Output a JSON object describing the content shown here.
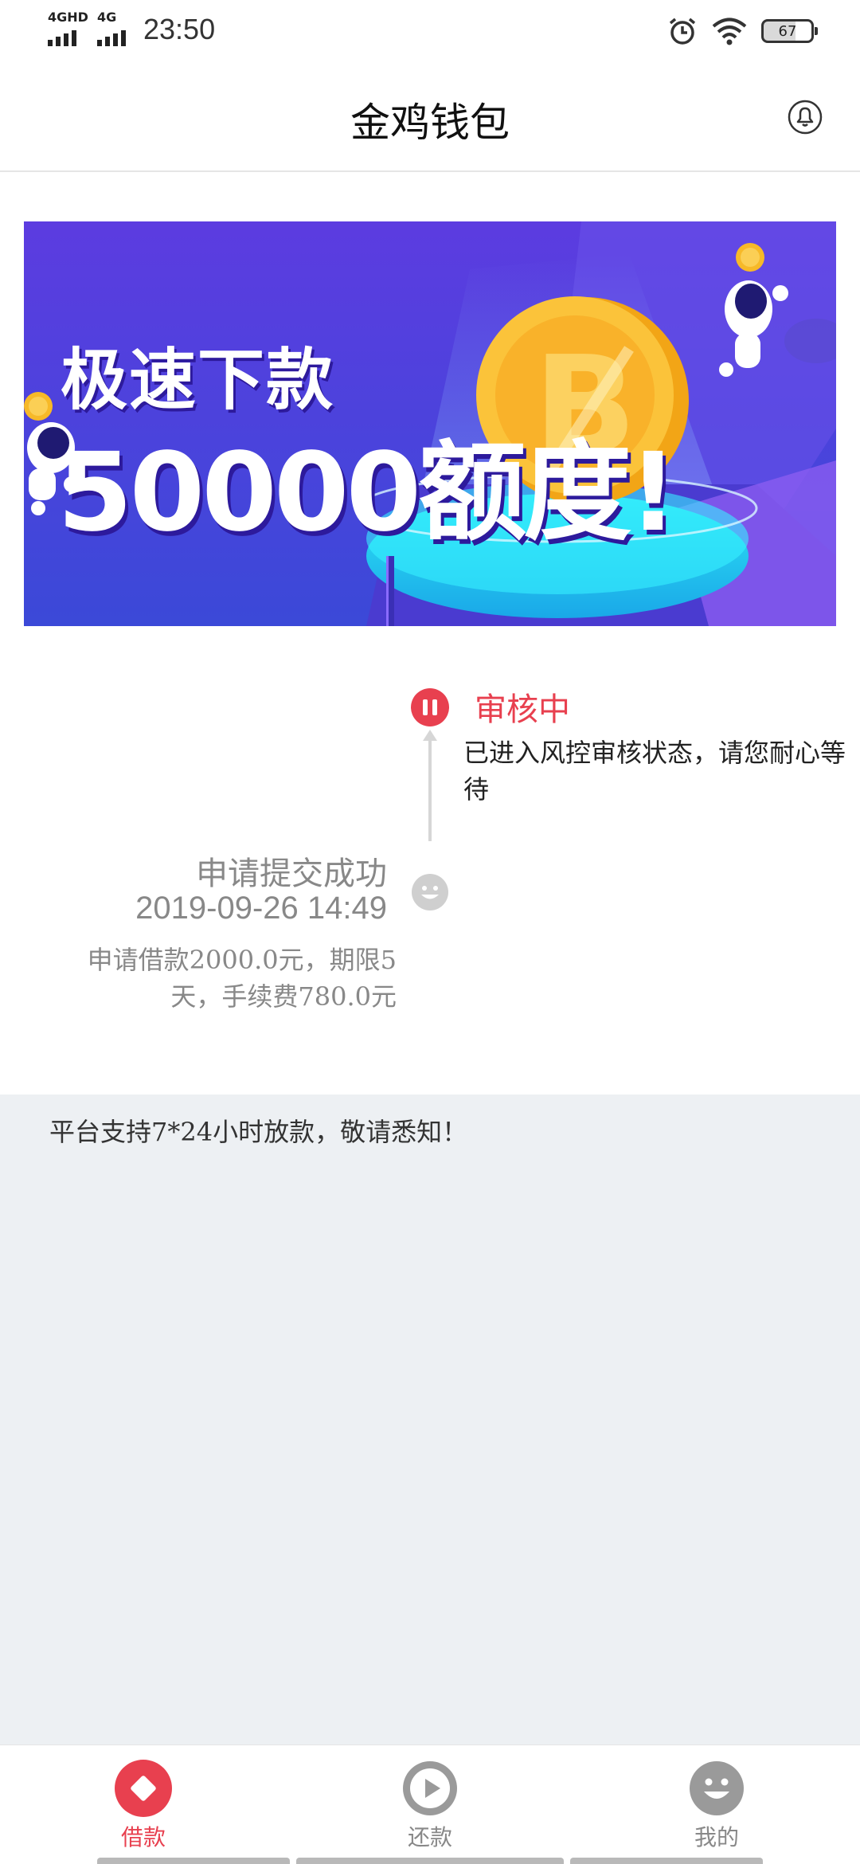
{
  "status_bar": {
    "network_1": "4GHD",
    "network_2": "4G",
    "time": "23:50",
    "battery": "67",
    "icons": [
      "alarm-icon",
      "wifi-icon",
      "battery-icon"
    ]
  },
  "header": {
    "title": "金鸡钱包",
    "bell_icon": "bell-icon"
  },
  "banner": {
    "line1": "极速下款",
    "line2": "50000额度!",
    "colors": {
      "bg_top": "#5b3fe0",
      "bg_bottom": "#3c47d9",
      "coin": "#f7b928",
      "platform": "#22d3f0"
    }
  },
  "timeline": {
    "current": {
      "title": "审核中",
      "description": "已进入风控审核状态，请您耐心等待",
      "icon": "pause-icon"
    },
    "previous": {
      "title": "申请提交成功",
      "time": "2019-09-26 14:49",
      "description": "申请借款2000.0元，期限5天，手续费780.0元",
      "icon": "smiley-icon"
    }
  },
  "notice": {
    "text": "平台支持7*24小时放款，敬请悉知！"
  },
  "bottom_nav": {
    "items": [
      {
        "label": "借款",
        "icon": "diamond-icon",
        "active": true
      },
      {
        "label": "还款",
        "icon": "play-icon",
        "active": false
      },
      {
        "label": "我的",
        "icon": "smiley-icon",
        "active": false
      }
    ]
  },
  "colors": {
    "accent": "#e8404f",
    "muted": "#888888",
    "notice_bg": "#edf0f3"
  }
}
